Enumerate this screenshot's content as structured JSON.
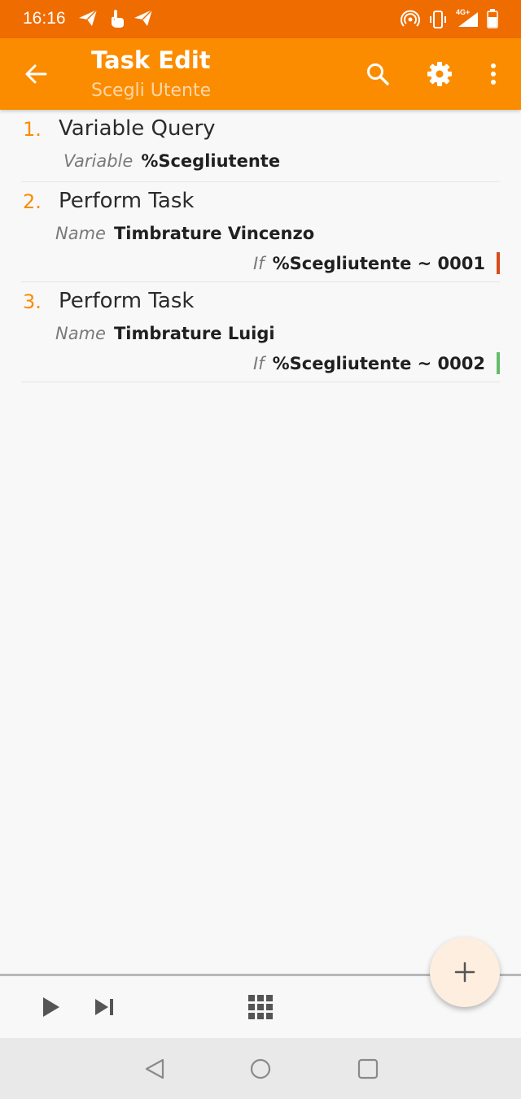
{
  "status_bar": {
    "time": "16:16",
    "network_label": "4G+",
    "icons": [
      "paper-plane-icon",
      "touch-hand-icon",
      "paper-plane-icon",
      "hotspot-icon",
      "vibrate-icon",
      "signal-icon",
      "battery-icon"
    ]
  },
  "app_bar": {
    "title": "Task Edit",
    "subtitle": "Scegli Utente",
    "icons": [
      "back-arrow-icon",
      "search-icon",
      "gear-icon",
      "more-vert-icon"
    ]
  },
  "actions": [
    {
      "number": "1.",
      "name": "Variable Query",
      "param_key": "Variable",
      "param_value": "%Scegliutente"
    },
    {
      "number": "2.",
      "name": "Perform Task",
      "param_key": "Name",
      "param_value": "Timbrature Vincenzo",
      "cond_key": "If",
      "cond_value": "%Scegliutente ~ 0001",
      "cond_color": "#d84a1b"
    },
    {
      "number": "3.",
      "name": "Perform Task",
      "param_key": "Name",
      "param_value": "Timbrature Luigi",
      "cond_key": "If",
      "cond_value": "%Scegliutente ~ 0002",
      "cond_color": "#66bb6a"
    }
  ],
  "bottom_toolbar": {
    "icons": [
      "play-icon",
      "step-icon",
      "grid-icon",
      "plus-icon"
    ]
  },
  "nav_bar": {
    "icons": [
      "nav-back-icon",
      "nav-home-icon",
      "nav-recents-icon"
    ]
  },
  "colors": {
    "status_bar": "#ef6c00",
    "app_bar": "#fb8c00",
    "accent": "#fb8c00",
    "background": "#f8f8f8"
  }
}
